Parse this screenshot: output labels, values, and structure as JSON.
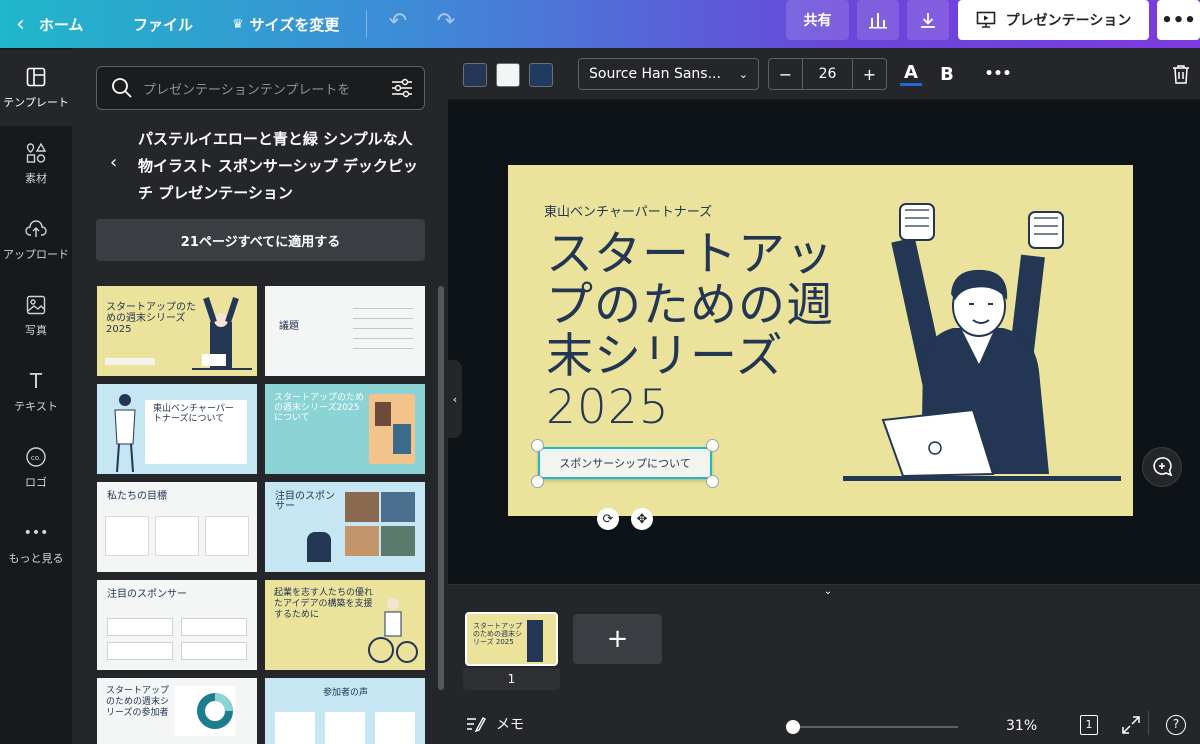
{
  "topbar": {
    "home": "ホーム",
    "file": "ファイル",
    "resize": "サイズを変更",
    "share": "共有",
    "present": "プレゼンテーション",
    "more": "•••"
  },
  "rail": {
    "items": [
      {
        "label": "テンプレート",
        "icon": "template-icon"
      },
      {
        "label": "素材",
        "icon": "elements-icon"
      },
      {
        "label": "アップロード",
        "icon": "upload-icon"
      },
      {
        "label": "写真",
        "icon": "photo-icon"
      },
      {
        "label": "テキスト",
        "icon": "text-icon"
      },
      {
        "label": "ロゴ",
        "icon": "logo-icon"
      },
      {
        "label": "もっと見る",
        "icon": "more-icon"
      }
    ]
  },
  "panel": {
    "search_placeholder": "プレゼンテーションテンプレートを",
    "template_title": "パステルイエローと青と緑 シンプルな人物イラスト スポンサーシップ デックピッチ プレゼンテーション",
    "apply_all": "21ページすべてに適用する",
    "thumbnails": [
      {
        "title": "スタートアップのための週末シリーズ 2025"
      },
      {
        "title": "議題"
      },
      {
        "title": "東山ベンチャーパートナーズについて"
      },
      {
        "title": "スタートアップのための週末シリーズ2025について"
      },
      {
        "title": "私たちの目標"
      },
      {
        "title": "注目のスポンサー"
      },
      {
        "title": "注目のスポンサー"
      },
      {
        "title": "起業を志す人たちの優れたアイデアの構築を支援するために"
      },
      {
        "title": "スタートアップのための週末シリーズの参加者"
      },
      {
        "title": "参加者の声"
      }
    ]
  },
  "editor": {
    "colors": [
      "#233654",
      "#f4f5f5",
      "#1e3a5f"
    ],
    "font": "Source Han Sans...",
    "font_size": "26",
    "bold": "B",
    "text_color_label": "A"
  },
  "slide": {
    "company": "東山ベンチャーパートナーズ",
    "title": "スタートアップのための週末シリーズ 2025",
    "button": "スポンサーシップについて"
  },
  "pages": {
    "page_number": "1",
    "add": "+"
  },
  "footer": {
    "memo": "メモ",
    "zoom": "31%",
    "page_count": "1",
    "zoom_level": 0.03
  }
}
